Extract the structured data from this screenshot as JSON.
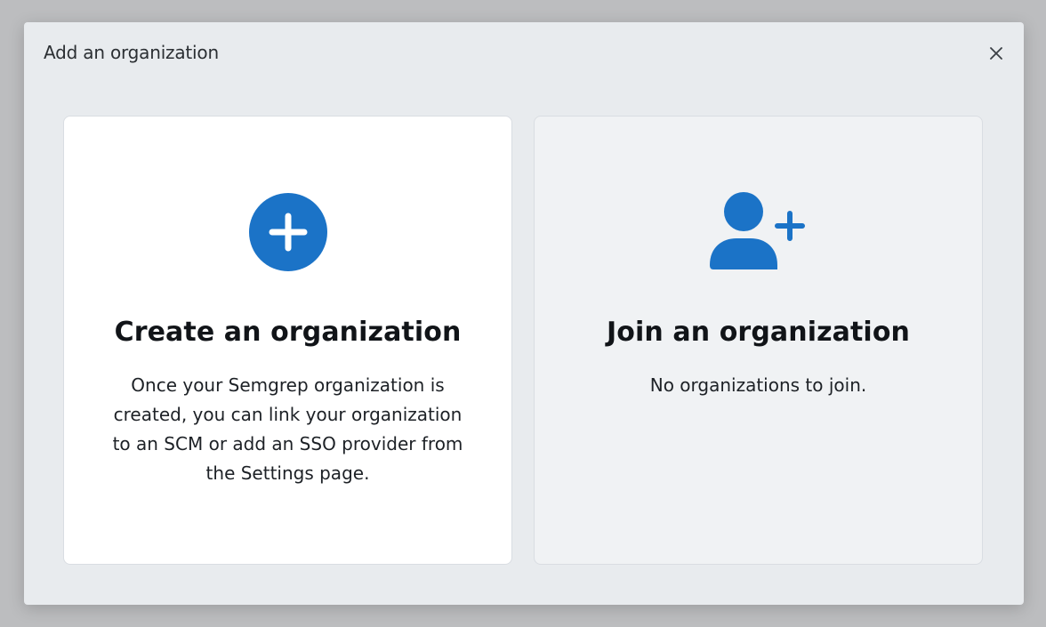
{
  "dialog": {
    "title": "Add an organization",
    "close_icon": "close-icon"
  },
  "create_card": {
    "icon": "plus-circle-icon",
    "title": "Create an organization",
    "description": "Once your Semgrep organization is created, you can link your organization to an SCM or add an SSO provider from the Settings page."
  },
  "join_card": {
    "icon": "user-plus-icon",
    "title": "Join an organization",
    "description": "No organizations to join."
  },
  "colors": {
    "accent": "#1b73c7",
    "overlay": "#bcbdbf",
    "dialog_bg": "#e8ebee"
  }
}
